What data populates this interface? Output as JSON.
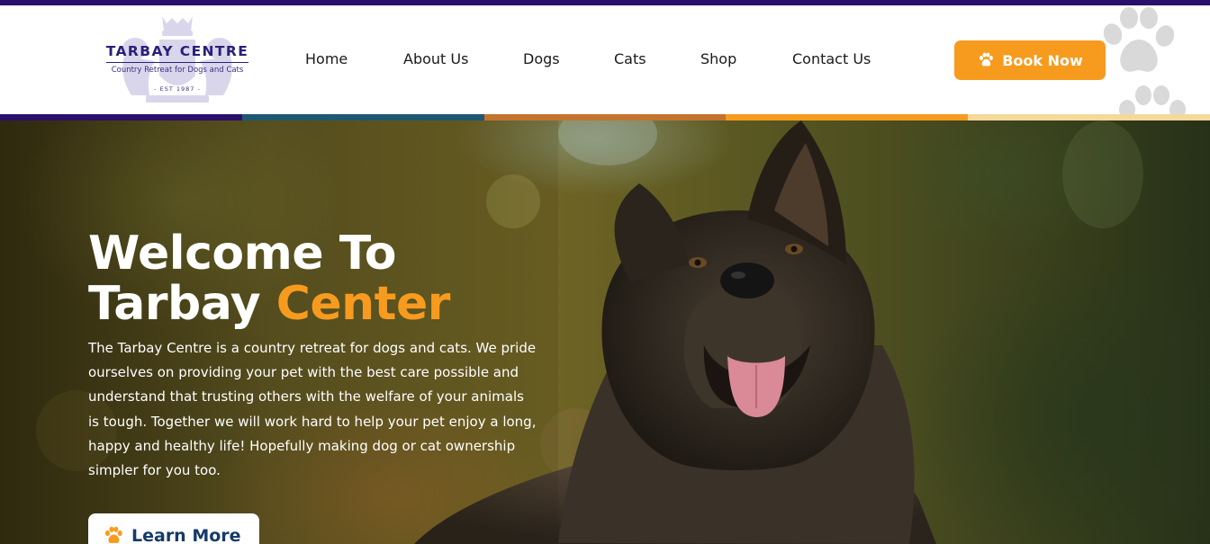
{
  "brand": {
    "name": "TARBAY CENTRE",
    "tagline": "Country Retreat for Dogs and Cats",
    "est": "- EST 1987 -"
  },
  "nav": {
    "items": [
      {
        "label": "Home"
      },
      {
        "label": "About Us"
      },
      {
        "label": "Dogs"
      },
      {
        "label": "Cats"
      },
      {
        "label": "Shop"
      },
      {
        "label": "Contact Us"
      }
    ]
  },
  "header": {
    "book_label": "Book Now",
    "book_icon": "paw-icon"
  },
  "colors": {
    "primary": "#2a0f6b",
    "accent": "#f79b1f",
    "band": [
      "#2a0f6b",
      "#1f5872",
      "#c4742f",
      "#f79b1f",
      "#f5d99a"
    ],
    "button_text": "#163a6b"
  },
  "hero": {
    "title_line1": "Welcome To",
    "title_line2": "Tarbay",
    "title_accent": "Center",
    "body": "The Tarbay Centre is a country retreat for dogs and cats. We pride ourselves on providing your pet with the best care possible and understand that trusting others with the welfare of your animals is tough. Together we will work hard to help your pet enjoy a long, happy and healthy life! Hopefully making dog or cat ownership simpler for you too.",
    "cta_label": "Learn More",
    "cta_icon": "paw-icon"
  }
}
